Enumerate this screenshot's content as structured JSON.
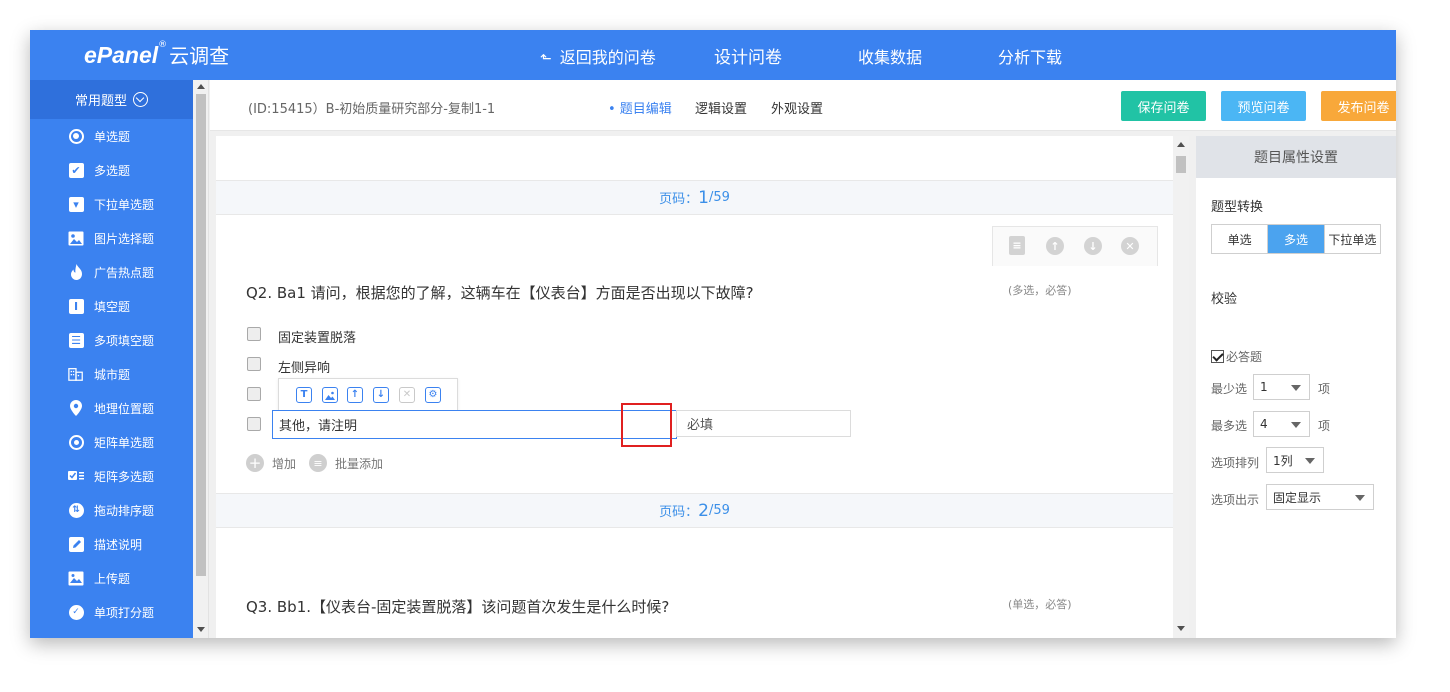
{
  "app": {
    "brand": "ePanel",
    "brand_mark": "®",
    "brand_sub": "云调查"
  },
  "topnav": {
    "back": "返回我的问卷",
    "design": "设计问卷",
    "collect": "收集数据",
    "analyze": "分析下载"
  },
  "sidebar": {
    "header": "常用题型",
    "items": [
      {
        "label": "单选题",
        "icon": "radio-icon"
      },
      {
        "label": "多选题",
        "icon": "checkbox-icon"
      },
      {
        "label": "下拉单选题",
        "icon": "dropdown-icon"
      },
      {
        "label": "图片选择题",
        "icon": "image-icon"
      },
      {
        "label": "广告热点题",
        "icon": "flame-icon"
      },
      {
        "label": "填空题",
        "icon": "text-input-icon"
      },
      {
        "label": "多项填空题",
        "icon": "multi-fill-icon"
      },
      {
        "label": "城市题",
        "icon": "city-icon"
      },
      {
        "label": "地理位置题",
        "icon": "location-pin-icon"
      },
      {
        "label": "矩阵单选题",
        "icon": "matrix-radio-icon"
      },
      {
        "label": "矩阵多选题",
        "icon": "matrix-checkbox-icon"
      },
      {
        "label": "拖动排序题",
        "icon": "sort-icon"
      },
      {
        "label": "描述说明",
        "icon": "pencil-icon"
      },
      {
        "label": "上传题",
        "icon": "upload-icon"
      },
      {
        "label": "单项打分题",
        "icon": "score-icon"
      }
    ]
  },
  "subheader": {
    "survey_title": "(ID:15415）B-初始质量研究部分-复制1-1",
    "tabs": {
      "edit": "• 题目编辑",
      "logic": "逻辑设置",
      "appearance": "外观设置"
    },
    "buttons": {
      "save": "保存问卷",
      "preview": "预览问卷",
      "publish": "发布问卷"
    }
  },
  "colors": {
    "primary": "#3b82f0",
    "save": "#21c3a5",
    "preview": "#4bb6f4",
    "publish": "#f8a83a",
    "highlight": "#e02020"
  },
  "canvas": {
    "page1": {
      "label": "页码：",
      "current": "1",
      "total": "/59"
    },
    "page2": {
      "label": "页码：",
      "current": "2",
      "total": "/59"
    },
    "q2": {
      "title": "Q2.  Ba1 请问，根据您的了解，这辆车在【仪表台】方面是否出现以下故障?",
      "tag": "(多选，必答)",
      "options": [
        "固定装置脱落",
        "左侧异响"
      ],
      "other_value": "其他，请注明",
      "required_value": "必填",
      "add_label": "增加",
      "bulk_add_label": "批量添加"
    },
    "q3": {
      "title": "Q3.  Bb1.【仪表台-固定装置脱落】该问题首次发生是什么时候?",
      "tag": "(单选，必答)"
    }
  },
  "rpanel": {
    "header": "题目属性设置",
    "type_switch_label": "题型转换",
    "type_options": [
      "单选",
      "多选",
      "下拉单选"
    ],
    "type_selected": "多选",
    "validation_label": "校验",
    "required_label": "必答题",
    "required_checked": true,
    "min_label": "最少选",
    "min_value": "1",
    "min_unit": "项",
    "max_label": "最多选",
    "max_value": "4",
    "max_unit": "项",
    "layout_label": "选项排列",
    "layout_value": "1列",
    "display_label": "选项出示",
    "display_value": "固定显示"
  }
}
